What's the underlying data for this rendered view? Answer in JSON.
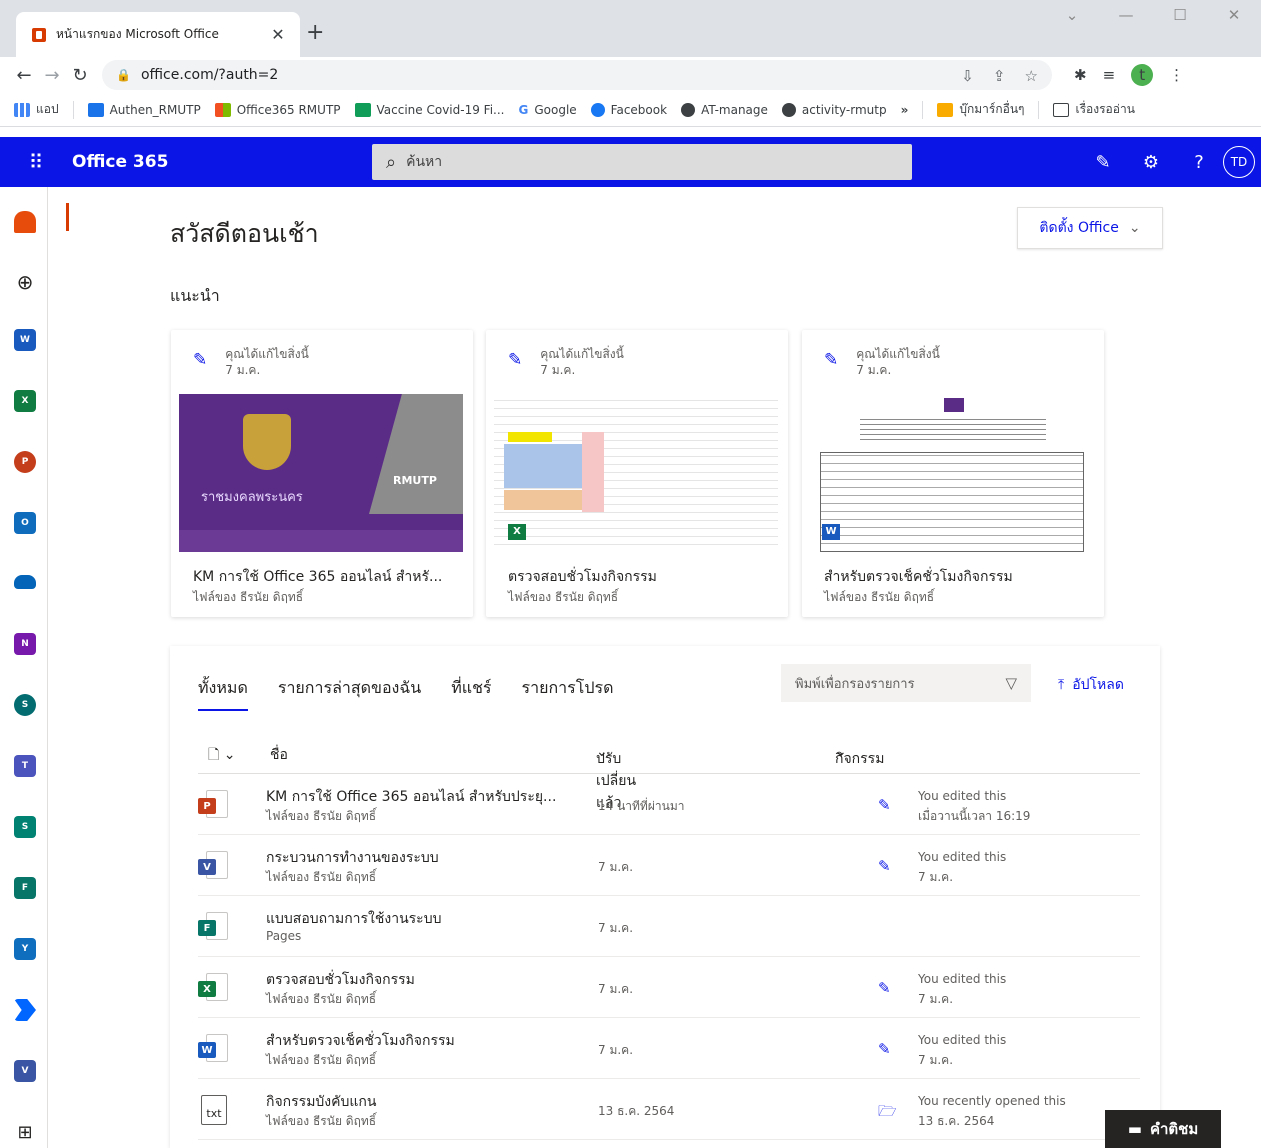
{
  "browser": {
    "tab_title": "หน้าแรกของ Microsoft Office",
    "url": "office.com/?auth=2",
    "profile_initial": "t",
    "bookmarks": [
      {
        "label": "แอป"
      },
      {
        "label": "Authen_RMUTP"
      },
      {
        "label": "Office365 RMUTP"
      },
      {
        "label": "Vaccine Covid-19 Fi..."
      },
      {
        "label": "Google"
      },
      {
        "label": "Facebook"
      },
      {
        "label": "AT-manage"
      },
      {
        "label": "activity-rmutp"
      },
      {
        "label": "»"
      },
      {
        "label": "บุ๊กมาร์กอื่นๆ"
      },
      {
        "label": "เรื่องรออ่าน"
      }
    ]
  },
  "header": {
    "brand": "Office 365",
    "search_placeholder": "ค้นหา",
    "avatar_initials": "TD",
    "accent": "#0b16e6"
  },
  "main": {
    "greeting": "สวัสดีตอนเช้า",
    "install_label": "ติดตั้ง Office",
    "recommended_title": "แนะนำ",
    "cards": [
      {
        "note": "คุณได้แก้ไขสิ่งนี้",
        "date": "7 ม.ค.",
        "title": "KM การใช้ Office 365 ออนไลน์ สำหรั...",
        "owner": "ไฟล์ของ ธีรนัย ดิฤทธิ์",
        "thumb_text_1": "RMUTP",
        "thumb_text_2": "ราชมงคลพระนคร"
      },
      {
        "note": "คุณได้แก้ไขสิ่งนี้",
        "date": "7 ม.ค.",
        "title": "ตรวจสอบชั่วโมงกิจกรรม",
        "owner": "ไฟล์ของ ธีรนัย ดิฤทธิ์"
      },
      {
        "note": "คุณได้แก้ไขสิ่งนี้",
        "date": "7 ม.ค.",
        "title": "สำหรับตรวจเช็คชั่วโมงกิจกรรม",
        "owner": "ไฟล์ของ ธีรนัย ดิฤทธิ์"
      }
    ],
    "tabs": [
      "ทั้งหมด",
      "รายการล่าสุดของฉัน",
      "ที่แชร์",
      "รายการโปรด"
    ],
    "filter_placeholder": "พิมพ์เพื่อกรองรายการ",
    "upload_label": "อัปโหลด",
    "columns": {
      "name": "ชื่อ",
      "modified": "ปรับเปลี่ยนแล้ว",
      "activity": "กิจกรรม"
    },
    "files": [
      {
        "name": "KM การใช้ Office 365 ออนไลน์ สำหรับประยุ...",
        "owner": "ไฟล์ของ ธีรนัย ดิฤทธิ์",
        "modified": "14 นาทีที่ผ่านมา",
        "activity": "You edited this",
        "activity_when": "เมื่อวานนี้เวลา 16:19",
        "type": "P",
        "color": "#c43e1c"
      },
      {
        "name": "กระบวนการทำงานของระบบ",
        "owner": "ไฟล์ของ ธีรนัย ดิฤทธิ์",
        "modified": "7 ม.ค.",
        "activity": "You edited this",
        "activity_when": "7 ม.ค.",
        "type": "V",
        "color": "#3955a3"
      },
      {
        "name": "แบบสอบถามการใช้งานระบบ",
        "owner": "Pages",
        "modified": "7 ม.ค.",
        "activity": "",
        "activity_when": "",
        "type": "F",
        "color": "#077568"
      },
      {
        "name": "ตรวจสอบชั่วโมงกิจกรรม",
        "owner": "ไฟล์ของ ธีรนัย ดิฤทธิ์",
        "modified": "7 ม.ค.",
        "activity": "You edited this",
        "activity_when": "7 ม.ค.",
        "type": "X",
        "color": "#107c41"
      },
      {
        "name": "สำหรับตรวจเช็คชั่วโมงกิจกรรม",
        "owner": "ไฟล์ของ ธีรนัย ดิฤทธิ์",
        "modified": "7 ม.ค.",
        "activity": "You edited this",
        "activity_when": "7 ม.ค.",
        "type": "W",
        "color": "#185abd"
      },
      {
        "name": "กิจกรรมบังคับแกน",
        "owner": "ไฟล์ของ ธีรนัย ดิฤทธิ์",
        "modified": "13 ธ.ค. 2564",
        "activity": "You recently opened this",
        "activity_when": "13 ธ.ค. 2564",
        "type": "txt",
        "color": "#605e5c"
      }
    ],
    "feedback_label": "คำติชม"
  }
}
